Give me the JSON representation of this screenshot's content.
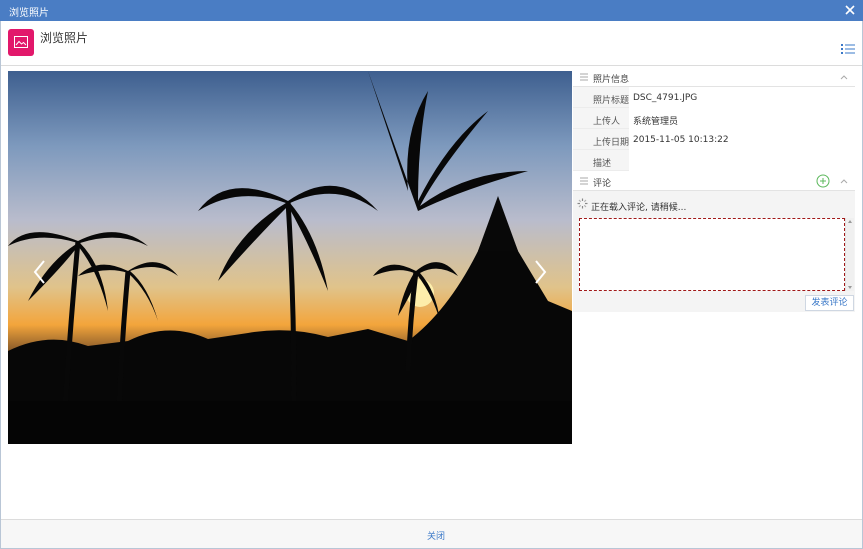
{
  "window": {
    "title": "浏览照片",
    "close_icon": "close-icon"
  },
  "header": {
    "app_title": "浏览照片",
    "app_icon": "image-icon",
    "menu_icon": "list-icon",
    "accent": "#e2186b"
  },
  "viewer": {
    "prev_icon": "chevron-left-icon",
    "next_icon": "chevron-right-icon"
  },
  "photo_info": {
    "section_title": "照片信息",
    "rows": [
      {
        "label": "照片标题",
        "value": "DSC_4791.JPG"
      },
      {
        "label": "上传人",
        "value": "系统管理员"
      },
      {
        "label": "上传日期",
        "value": "2015-11-05 10:13:22"
      },
      {
        "label": "描述",
        "value": ""
      }
    ]
  },
  "comments": {
    "section_title": "评论",
    "loading_text": "正在载入评论, 请稍候...",
    "input_value": "",
    "post_label": "发表评论"
  },
  "footer": {
    "close_label": "关闭"
  },
  "colors": {
    "titlebar": "#4a7dc4",
    "link": "#3a78c8",
    "add": "#5cb85c"
  }
}
